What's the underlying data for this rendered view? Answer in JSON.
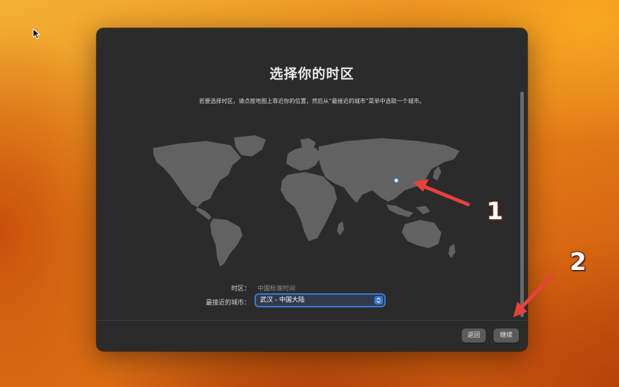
{
  "setup": {
    "title": "选择你的时区",
    "description": "若要选择时区，请点按地图上靠近你的位置，然后从“最接近的城市”菜单中选取一个城市。",
    "timezone": {
      "label": "时区：",
      "value": "中国标准时间"
    },
    "closest_city": {
      "label": "最接近的城市：",
      "value": "武汉 - 中国大陆"
    },
    "buttons": {
      "back": "返回",
      "continue": "继续"
    }
  },
  "annotations": {
    "step1": "1",
    "step2": "2",
    "arrow_color": "#e8423c"
  },
  "icons": {
    "cursor": "arrow-cursor-icon",
    "select_chevron": "chevron-up-down-icon",
    "map_pin": "location-pin-icon"
  }
}
